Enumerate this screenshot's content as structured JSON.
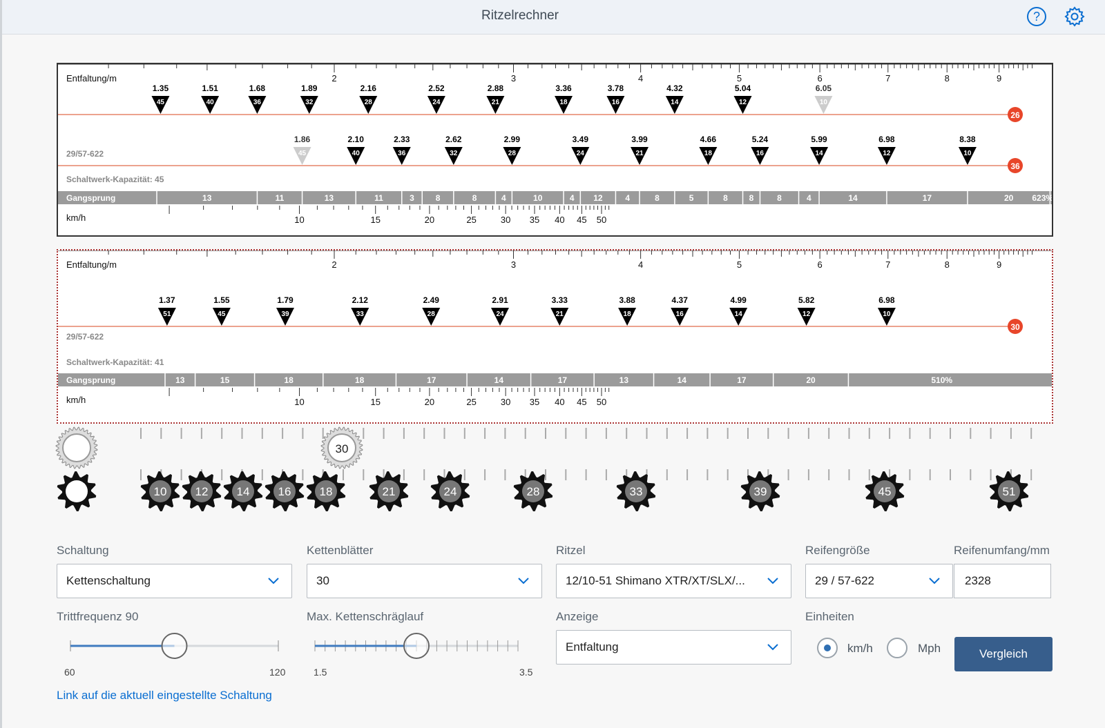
{
  "header": {
    "title": "Ritzelrechner"
  },
  "chart1": {
    "ent_label": "Entfaltung/m",
    "kmh_label": "km/h",
    "tire_label": "29/57-622",
    "capacity": "Schaltwerk-Kapazität: 45",
    "gangsprung_label": "Gangsprung",
    "ent_ticks": [
      "2",
      "3",
      "4",
      "5",
      "6",
      "7",
      "8",
      "9"
    ],
    "kmh_ticks": [
      "10",
      "15",
      "20",
      "25",
      "30",
      "35",
      "40",
      "45",
      "50"
    ],
    "row1": {
      "chainring": "26",
      "gears": [
        {
          "dev": "1.35",
          "teeth": "45"
        },
        {
          "dev": "1.51",
          "teeth": "40"
        },
        {
          "dev": "1.68",
          "teeth": "36"
        },
        {
          "dev": "1.89",
          "teeth": "32"
        },
        {
          "dev": "2.16",
          "teeth": "28"
        },
        {
          "dev": "2.52",
          "teeth": "24"
        },
        {
          "dev": "2.88",
          "teeth": "21"
        },
        {
          "dev": "3.36",
          "teeth": "18"
        },
        {
          "dev": "3.78",
          "teeth": "16"
        },
        {
          "dev": "4.32",
          "teeth": "14"
        },
        {
          "dev": "5.04",
          "teeth": "12"
        },
        {
          "dev": "6.05",
          "teeth": "10",
          "faded": true
        }
      ]
    },
    "row2": {
      "chainring": "36",
      "gears": [
        {
          "dev": "1.86",
          "teeth": "45",
          "faded": true
        },
        {
          "dev": "2.10",
          "teeth": "40"
        },
        {
          "dev": "2.33",
          "teeth": "36"
        },
        {
          "dev": "2.62",
          "teeth": "32"
        },
        {
          "dev": "2.99",
          "teeth": "28"
        },
        {
          "dev": "3.49",
          "teeth": "24"
        },
        {
          "dev": "3.99",
          "teeth": "21"
        },
        {
          "dev": "4.66",
          "teeth": "18"
        },
        {
          "dev": "5.24",
          "teeth": "16"
        },
        {
          "dev": "5.99",
          "teeth": "14"
        },
        {
          "dev": "6.98",
          "teeth": "12"
        },
        {
          "dev": "8.38",
          "teeth": "10"
        }
      ]
    },
    "gangsprung": [
      {
        "v": "13",
        "e": 1.68
      },
      {
        "v": "11",
        "e": 1.86
      },
      {
        "v": "13",
        "e": 2.1
      },
      {
        "v": "11",
        "e": 2.33
      },
      {
        "v": "3",
        "e": 2.44
      },
      {
        "v": "8",
        "e": 2.62
      },
      {
        "v": "8",
        "e": 2.88
      },
      {
        "v": "4",
        "e": 2.99
      },
      {
        "v": "10",
        "e": 3.36
      },
      {
        "v": "4",
        "e": 3.49
      },
      {
        "v": "12",
        "e": 3.78
      },
      {
        "v": "4",
        "e": 3.99
      },
      {
        "v": "8",
        "e": 4.32
      },
      {
        "v": "5",
        "e": 4.66
      },
      {
        "v": "8",
        "e": 5.04
      },
      {
        "v": "8",
        "e": 5.24
      },
      {
        "v": "8",
        "e": 5.72
      },
      {
        "v": "4",
        "e": 5.99
      },
      {
        "v": "14",
        "e": 6.98
      },
      {
        "v": "17",
        "e": 8.38
      },
      {
        "v": "20",
        "e": 10.1
      },
      {
        "v": "623%",
        "e": null
      }
    ]
  },
  "chart2": {
    "ent_label": "Entfaltung/m",
    "kmh_label": "km/h",
    "tire_label": "29/57-622",
    "capacity": "Schaltwerk-Kapazität: 41",
    "gangsprung_label": "Gangsprung",
    "ent_ticks": [
      "2",
      "3",
      "4",
      "5",
      "6",
      "7",
      "8",
      "9"
    ],
    "kmh_ticks": [
      "10",
      "15",
      "20",
      "25",
      "30",
      "35",
      "40",
      "45",
      "50"
    ],
    "row1": {
      "chainring": "30",
      "gears": [
        {
          "dev": "1.37",
          "teeth": "51"
        },
        {
          "dev": "1.55",
          "teeth": "45"
        },
        {
          "dev": "1.79",
          "teeth": "39"
        },
        {
          "dev": "2.12",
          "teeth": "33"
        },
        {
          "dev": "2.49",
          "teeth": "28"
        },
        {
          "dev": "2.91",
          "teeth": "24"
        },
        {
          "dev": "3.33",
          "teeth": "21"
        },
        {
          "dev": "3.88",
          "teeth": "18"
        },
        {
          "dev": "4.37",
          "teeth": "16"
        },
        {
          "dev": "4.99",
          "teeth": "14"
        },
        {
          "dev": "5.82",
          "teeth": "12"
        },
        {
          "dev": "6.98",
          "teeth": "10"
        }
      ]
    },
    "gangsprung": [
      {
        "v": "13",
        "e": 1.46
      },
      {
        "v": "15",
        "e": 1.67
      },
      {
        "v": "18",
        "e": 1.95
      },
      {
        "v": "18",
        "e": 2.3
      },
      {
        "v": "17",
        "e": 2.7
      },
      {
        "v": "14",
        "e": 3.12
      },
      {
        "v": "17",
        "e": 3.6
      },
      {
        "v": "13",
        "e": 4.12
      },
      {
        "v": "14",
        "e": 4.68
      },
      {
        "v": "17",
        "e": 5.4
      },
      {
        "v": "20",
        "e": 6.4
      },
      {
        "v": "510%",
        "e": null
      }
    ]
  },
  "gears_strip": {
    "chainring_teeth": "30",
    "cogs": [
      "10",
      "12",
      "14",
      "16",
      "18",
      "21",
      "24",
      "28",
      "33",
      "39",
      "45",
      "51"
    ]
  },
  "form": {
    "schaltung_label": "Schaltung",
    "schaltung_value": "Kettenschaltung",
    "kettenblaetter_label": "Kettenblätter",
    "kettenblaetter_value": "30",
    "ritzel_label": "Ritzel",
    "ritzel_value": "12/10-51 Shimano XTR/XT/SLX/...",
    "reifen_label": "Reifengröße",
    "reifen_value": "29 / 57-622",
    "umfang_label": "Reifenumfang/mm",
    "umfang_value": "2328",
    "tritt_label": "Trittfrequenz 90",
    "tritt_min": "60",
    "tritt_max": "120",
    "tritt_value": 90,
    "schraeg_label": "Max. Kettenschräglauf",
    "schraeg_min": "1.5",
    "schraeg_max": "3.5",
    "schraeg_value": 2.5,
    "anzeige_label": "Anzeige",
    "anzeige_value": "Entfaltung",
    "einheiten_label": "Einheiten",
    "unit_kmh": "km/h",
    "unit_mph": "Mph",
    "vergleich": "Vergleich",
    "link": "Link auf die aktuell eingestellte Schaltung"
  }
}
